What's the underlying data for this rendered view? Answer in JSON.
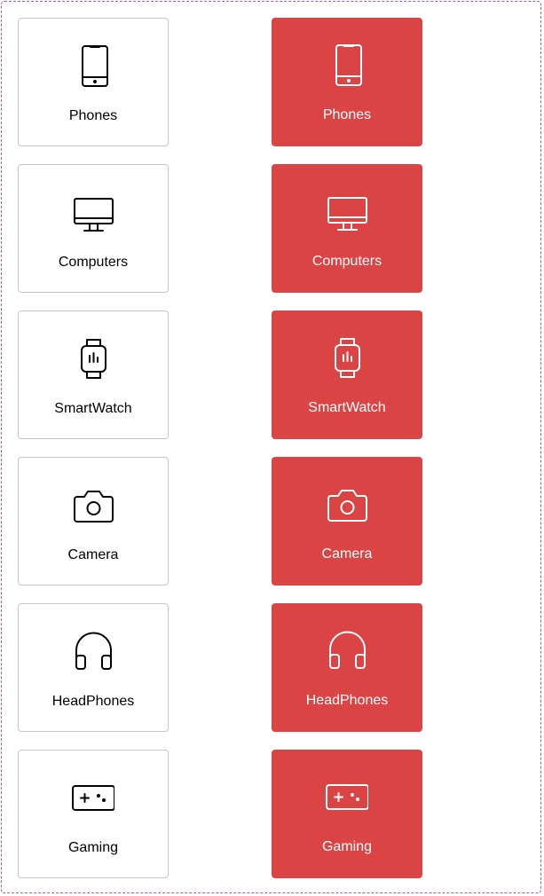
{
  "colors": {
    "accent": "#db4444",
    "border": "#c7c7c7",
    "frame": "#9b59d6"
  },
  "categories": [
    {
      "label": "Phones",
      "icon": "phone-icon"
    },
    {
      "label": "Computers",
      "icon": "computer-icon"
    },
    {
      "label": "SmartWatch",
      "icon": "smartwatch-icon"
    },
    {
      "label": "Camera",
      "icon": "camera-icon"
    },
    {
      "label": "HeadPhones",
      "icon": "headphones-icon"
    },
    {
      "label": "Gaming",
      "icon": "gamepad-icon"
    }
  ]
}
